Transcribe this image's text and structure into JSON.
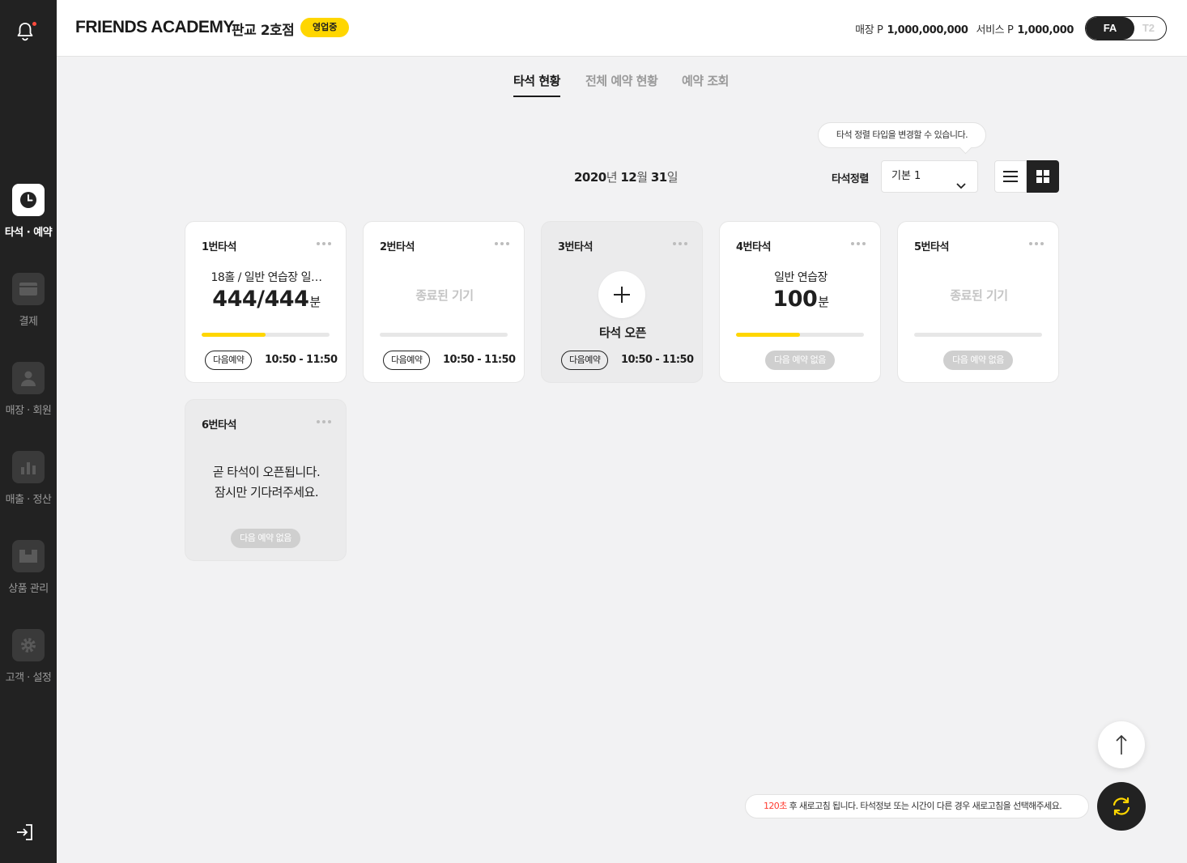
{
  "sidebar": {
    "items": [
      {
        "label": "타석 · 예약",
        "icon": "clock-icon"
      },
      {
        "label": "결제",
        "icon": "card-icon"
      },
      {
        "label": "매장 · 회원",
        "icon": "user-icon"
      },
      {
        "label": "매출 · 정산",
        "icon": "chart-icon"
      },
      {
        "label": "상품 관리",
        "icon": "box-icon"
      },
      {
        "label": "고객 · 설정",
        "icon": "gear-icon"
      }
    ]
  },
  "header": {
    "brand": "FRIENDS ACADEMY",
    "branch": "판교 2호점",
    "status": "영업중",
    "store_point_label": "매장 P",
    "store_point_value": "1,000,000,000",
    "service_point_label": "서비스 P",
    "service_point_value": "1,000,000",
    "toggle_on": "FA",
    "toggle_off": "T2"
  },
  "tabs": [
    "타석 현황",
    "전체 예약 현황",
    "예약 조회"
  ],
  "tooltip": "타석 정렬 타입을 변경할 수 있습니다.",
  "date": {
    "year": "2020",
    "year_unit": "년",
    "month": "12",
    "month_unit": "월",
    "day": "31",
    "day_unit": "일"
  },
  "sort": {
    "label": "타석정렬",
    "value": "기본 1"
  },
  "cards": [
    {
      "title": "1번타석",
      "sub": "18홀 / 일반 연습장 일…",
      "big": "444/444",
      "unit": "분",
      "progress": 0.5,
      "next_label": "다음예약",
      "next_time": "10:50 - 11:50"
    },
    {
      "title": "2번타석",
      "ended": "종료된 기기",
      "progress": 0,
      "next_label": "다음예약",
      "next_time": "10:50 - 11:50"
    },
    {
      "title": "3번타석",
      "open_label": "타석 오픈",
      "next_label": "다음예약",
      "next_time": "10:50 - 11:50"
    },
    {
      "title": "4번타석",
      "sub": "일반 연습장",
      "big": "100",
      "unit": "분",
      "progress": 0.5,
      "no_next": "다음 예약 없음"
    },
    {
      "title": "5번타석",
      "ended": "종료된 기기",
      "progress": 0,
      "no_next": "다음 예약 없음"
    },
    {
      "title": "6번타석",
      "soon_line1": "곧 타석이 오픈됩니다.",
      "soon_line2": "잠시만 기다려주세요.",
      "no_next": "다음 예약 없음"
    }
  ],
  "refresh": {
    "seconds": "120초",
    "message": " 후 새로고침 됩니다. 타석정보 또는 시간이 다른 경우 새로고침을 선택해주세요."
  },
  "colors": {
    "accent": "#ffd600",
    "sidebar": "#222222",
    "alert": "#ff3b30"
  }
}
